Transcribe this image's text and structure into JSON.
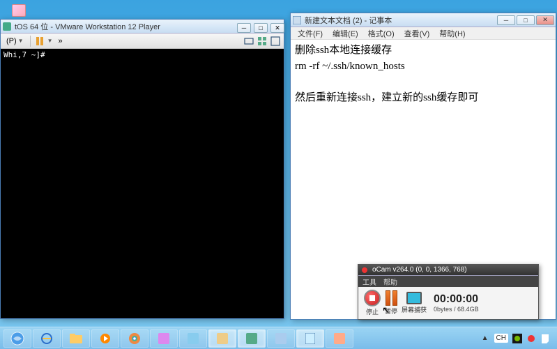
{
  "vmware": {
    "title": "tOS 64 位 - VMware Workstation 12 Player",
    "toolbar": {
      "player_label": "(P)",
      "send_label": "»"
    },
    "terminal_text": "Whi,7 ~]#"
  },
  "notepad": {
    "title": "新建文本文档 (2) - 记事本",
    "menu": {
      "file": "文件(F)",
      "edit": "编辑(E)",
      "format": "格式(O)",
      "view": "查看(V)",
      "help": "帮助(H)"
    },
    "content": "删除ssh本地连接缓存\nrm -rf ~/.ssh/known_hosts\n\n然后重新连接ssh，建立新的ssh缓存即可"
  },
  "ocam": {
    "title": "oCam v264.0 (0, 0, 1366, 768)",
    "menu": {
      "tools": "工具",
      "help": "帮助"
    },
    "btn_stop": "停止",
    "btn_pause": "暂停",
    "btn_capture": "屏幕捕获",
    "timer": "00:00:00",
    "status": "0bytes / 68.4GB"
  },
  "tray": {
    "lang": "CH"
  }
}
